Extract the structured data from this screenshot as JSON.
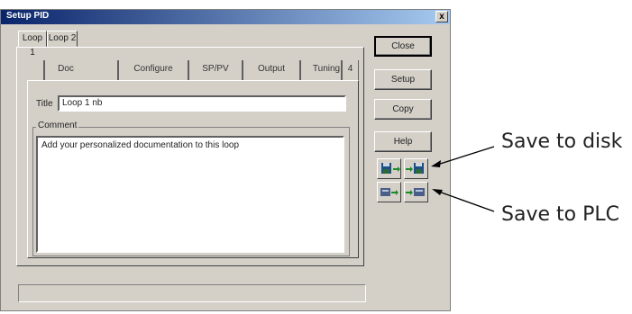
{
  "window": {
    "title": "Setup PID",
    "close_glyph": "x"
  },
  "outer_tabs": [
    {
      "label": "Loop 1"
    },
    {
      "label": "Loop 2"
    }
  ],
  "inner_tabs": [
    {
      "label": "Doc"
    },
    {
      "label": "Configure"
    },
    {
      "label": "SP/PV"
    },
    {
      "label": "Output"
    },
    {
      "label": "Tuning"
    },
    {
      "label": "4"
    }
  ],
  "doc": {
    "title_label": "Title",
    "title_value": "Loop 1 nb",
    "comment_label": "Comment",
    "comment_text": "Add your personalized documentation to this loop"
  },
  "buttons": {
    "close": "Close",
    "setup": "Setup",
    "copy": "Copy",
    "help": "Help"
  },
  "annotations": {
    "disk": "Save to disk",
    "plc": "Save to PLC"
  }
}
